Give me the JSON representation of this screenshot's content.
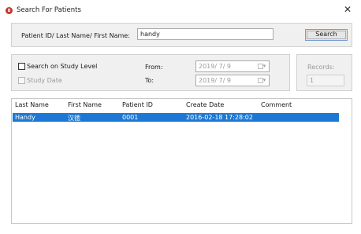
{
  "window": {
    "title": "Search For Patients",
    "close_icon": "close-icon",
    "app_icon": "app-icon"
  },
  "search": {
    "label": "Patient ID/ Last Name/ First Name:",
    "value": "handy",
    "button": "Search"
  },
  "filters": {
    "study_level_label": "Search on Study Level",
    "study_level_checked": false,
    "study_date_label": "Study Date",
    "study_date_checked": false,
    "from_label": "From:",
    "from_value": "2019/ 7/ 9",
    "to_label": "To:",
    "to_value": "2019/ 7/ 9"
  },
  "records": {
    "label": "Records:",
    "value": "1"
  },
  "table": {
    "columns": [
      "Last Name",
      "First Name",
      "Patient ID",
      "Create Date",
      "Comment"
    ],
    "rows": [
      {
        "last_name": "Handy",
        "first_name": "汉徳",
        "patient_id": "0001",
        "create_date": "2016-02-18 17:28:02",
        "comment": "",
        "selected": true
      }
    ]
  },
  "colors": {
    "selection": "#1c78d4",
    "panel": "#f0f0f0"
  }
}
